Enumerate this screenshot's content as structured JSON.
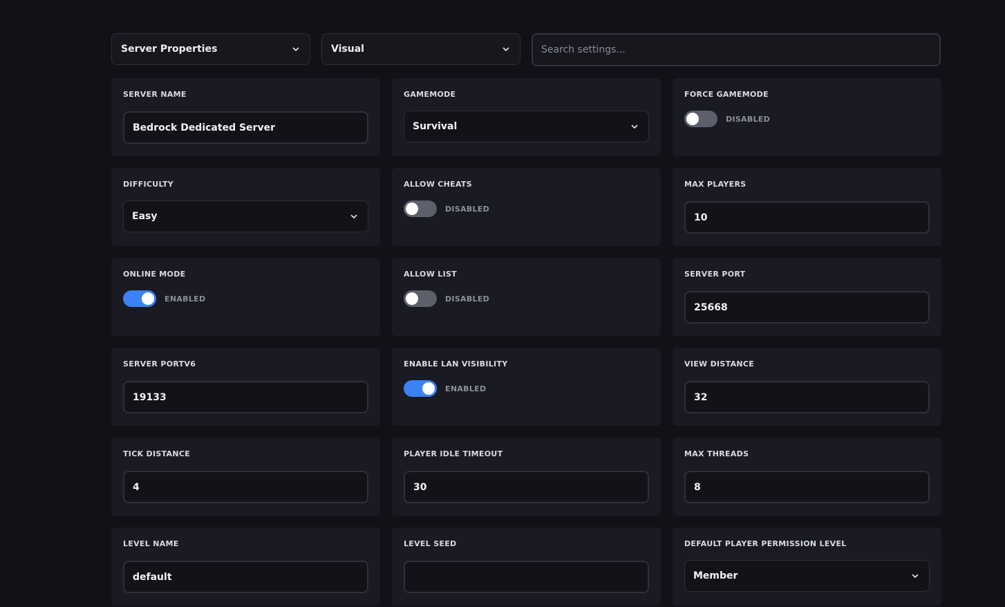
{
  "toolbar": {
    "category": "Server Properties",
    "view": "Visual",
    "search_placeholder": "Search settings..."
  },
  "settings": [
    {
      "label": "SERVER NAME",
      "type": "text",
      "value": "Bedrock Dedicated Server"
    },
    {
      "label": "GAMEMODE",
      "type": "select",
      "value": "Survival"
    },
    {
      "label": "FORCE GAMEMODE",
      "type": "toggle",
      "enabled": false,
      "state_text": "DISABLED"
    },
    {
      "label": "DIFFICULTY",
      "type": "select",
      "value": "Easy"
    },
    {
      "label": "ALLOW CHEATS",
      "type": "toggle",
      "enabled": false,
      "state_text": "DISABLED"
    },
    {
      "label": "MAX PLAYERS",
      "type": "text",
      "value": "10"
    },
    {
      "label": "ONLINE MODE",
      "type": "toggle",
      "enabled": true,
      "state_text": "ENABLED"
    },
    {
      "label": "ALLOW LIST",
      "type": "toggle",
      "enabled": false,
      "state_text": "DISABLED"
    },
    {
      "label": "SERVER PORT",
      "type": "text",
      "value": "25668"
    },
    {
      "label": "SERVER PORTV6",
      "type": "text",
      "value": "19133"
    },
    {
      "label": "ENABLE LAN VISIBILITY",
      "type": "toggle",
      "enabled": true,
      "state_text": "ENABLED"
    },
    {
      "label": "VIEW DISTANCE",
      "type": "text",
      "value": "32"
    },
    {
      "label": "TICK DISTANCE",
      "type": "text",
      "value": "4"
    },
    {
      "label": "PLAYER IDLE TIMEOUT",
      "type": "text",
      "value": "30"
    },
    {
      "label": "MAX THREADS",
      "type": "text",
      "value": "8"
    },
    {
      "label": "LEVEL NAME",
      "type": "text",
      "value": "default"
    },
    {
      "label": "LEVEL SEED",
      "type": "text",
      "value": ""
    },
    {
      "label": "DEFAULT PLAYER PERMISSION LEVEL",
      "type": "select",
      "value": "Member"
    }
  ],
  "colors": {
    "background": "#111117",
    "card": "#1a1a22",
    "accent": "#3b82f6",
    "toggle_off": "#5d5f6b"
  }
}
